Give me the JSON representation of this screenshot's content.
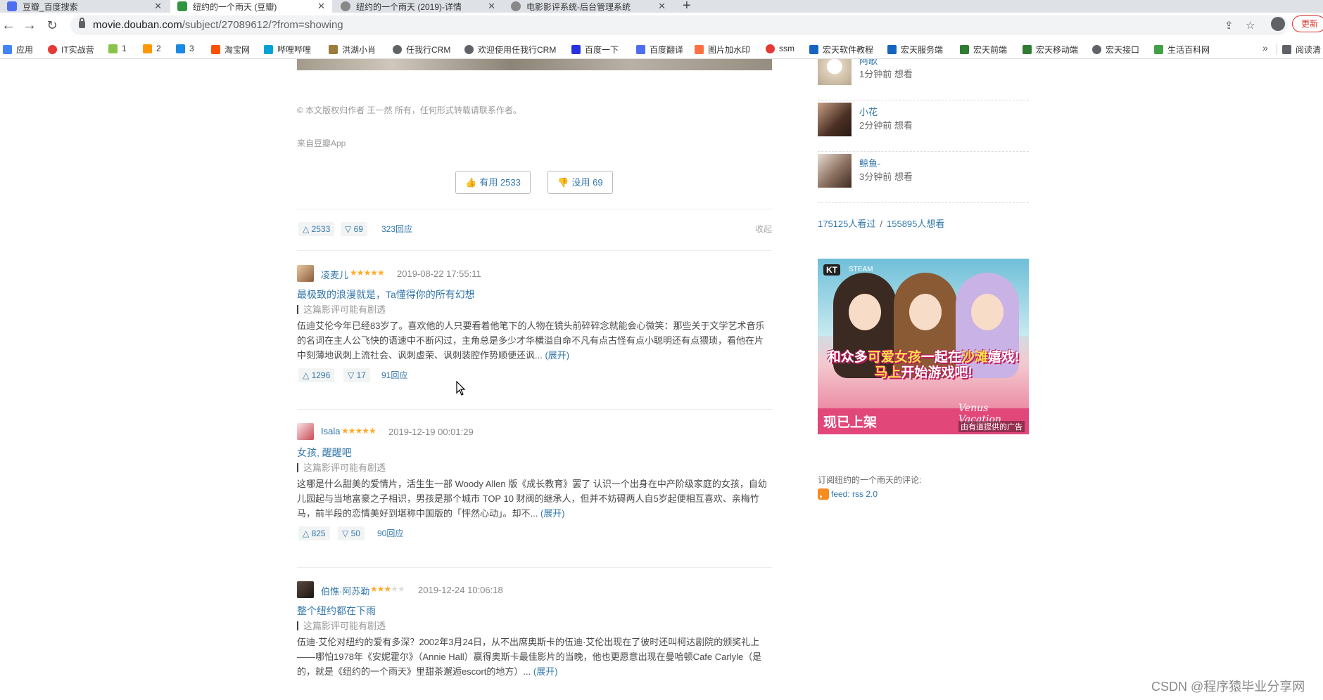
{
  "browser": {
    "tabs": [
      {
        "title": "豆瓣_百度搜索",
        "color": "#4e6ef2"
      },
      {
        "title": "纽约的一个雨天 (豆瓣)",
        "color": "#2e963d"
      },
      {
        "title": "纽约的一个雨天 (2019)-详情",
        "color": "#666666"
      },
      {
        "title": "电影影评系统-后台管理系统",
        "color": "#666666"
      }
    ],
    "new_tab": "+",
    "url_host": "movie.douban.com",
    "url_path": "/subject/27089612/?from=showing",
    "update_label": "更新",
    "bookmarks": [
      {
        "label": "应用",
        "icon": "apps-icon",
        "color": "#4285f4"
      },
      {
        "label": "IT实战营",
        "icon": "itshizhan-icon",
        "color": "#e53935"
      },
      {
        "label": "1",
        "icon": "bookmark-1-icon",
        "color": "#8bc34a"
      },
      {
        "label": "2",
        "icon": "bookmark-2-icon",
        "color": "#ff9800"
      },
      {
        "label": "3",
        "icon": "bookmark-3-icon",
        "color": "#1e88e5"
      },
      {
        "label": "淘宝网",
        "icon": "taobao-icon",
        "color": "#ff5000"
      },
      {
        "label": "哔哩哔哩",
        "icon": "bilibili-icon",
        "color": "#00a1d6"
      },
      {
        "label": "洪湖小肖",
        "icon": "honghu-icon",
        "color": "#9c7b3c"
      },
      {
        "label": "任我行CRM",
        "icon": "globe-icon",
        "color": "#5f6368"
      },
      {
        "label": "欢迎使用任我行CRM",
        "icon": "globe-icon",
        "color": "#5f6368"
      },
      {
        "label": "百度一下",
        "icon": "baidu-icon",
        "color": "#2932e1"
      },
      {
        "label": "百度翻译",
        "icon": "baidu-translate-icon",
        "color": "#4e6ef2"
      },
      {
        "label": "图片加水印",
        "icon": "watermark-tool-icon",
        "color": "#ff7043"
      },
      {
        "label": "ssm",
        "icon": "ssm-icon",
        "color": "#e53935"
      },
      {
        "label": "宏天软件教程",
        "icon": "hongtian-icon",
        "color": "#1565c0"
      },
      {
        "label": "宏天服务端",
        "icon": "hongtian-icon",
        "color": "#1565c0"
      },
      {
        "label": "宏天前端",
        "icon": "vue-icon",
        "color": "#2e7d32"
      },
      {
        "label": "宏天移动端",
        "icon": "vue-icon",
        "color": "#2e7d32"
      },
      {
        "label": "宏天接口",
        "icon": "globe-icon",
        "color": "#5f6368"
      },
      {
        "label": "生活百科网",
        "icon": "book-icon",
        "color": "#43a047"
      }
    ],
    "more_bookmarks": "»",
    "reading_list": "阅读清"
  },
  "main": {
    "copyright": "© 本文版权归作者  王一然  所有，任何形式转载请联系作者。",
    "from_app": "来自豆瓣App",
    "useful_button": "有用 2533",
    "useless_button": "没用 69",
    "main_actions": {
      "up": "2533",
      "down": "69",
      "replies": "323回应",
      "collect": "收起"
    },
    "reviews": [
      {
        "author": "凌麦儿",
        "stars": 5,
        "date": "2019-08-22 17:55:11",
        "title": "最极致的浪漫就是，Ta懂得你的所有幻想",
        "spoiler": "这篇影评可能有剧透",
        "body": "伍迪艾伦今年已经83岁了。喜欢他的人只要看着他笔下的人物在镜头前碎碎念就能会心微笑：那些关于文学艺术音乐的名词在主人公飞快的语速中不断闪过，主角总是多少才华横溢自命不凡有点古怪有点小聪明还有点猥琐，看他在片中刻薄地讽刺上流社会、讽刺虚荣、讽刺装腔作势顺便还讽...",
        "expand": "(展开)",
        "up": "1296",
        "down": "17",
        "replies": "91回应",
        "avatar_color": "#8a5a3c"
      },
      {
        "author": "Isala",
        "stars": 5,
        "date": "2019-12-19 00:01:29",
        "title": "女孩, 醒醒吧",
        "spoiler": "这篇影评可能有剧透",
        "body": "这哪是什么甜美的爱情片，活生生一部 Woody Allen 版《成长教育》罢了 认识一个出身在中产阶级家庭的女孩，自幼儿园起与当地富豪之子相识，男孩是那个城市 TOP 10 财阀的继承人，但并不妨碍两人自5岁起便相互喜欢、亲梅竹马，前半段的恋情美好到堪称中国版的「怦然心动」。却不...",
        "expand": "(展开)",
        "up": "825",
        "down": "50",
        "replies": "90回应",
        "avatar_color": "#d9a0a8"
      },
      {
        "author": "伯憔·阿苏勒",
        "stars": 3,
        "date": "2019-12-24 10:06:18",
        "title": "整个纽约都在下雨",
        "spoiler": "这篇影评可能有剧透",
        "body": "伍迪·艾伦对纽约的爱有多深？2002年3月24日，从不出席奥斯卡的伍迪·艾伦出现在了彼时还叫柯达剧院的颁奖礼上——哪怕1978年《安妮霍尔》（Annie Hall）赢得奥斯卡最佳影片的当晚，他也更愿意出现在曼哈顿Cafe Carlyle（是的，就是《纽约的一个雨天》里甜茶邂逅escort的地方）...",
        "expand": "(展开)",
        "avatar_color": "#3b2f2a"
      }
    ]
  },
  "sidebar": {
    "wishers": [
      {
        "name": "阿歌",
        "time": "1分钟前 想看",
        "avatar_color": "#d8c8b0"
      },
      {
        "name": "小花",
        "time": "2分钟前 想看",
        "avatar_color": "#6b4a3a"
      },
      {
        "name": "鲸鱼-",
        "time": "3分钟前 想看",
        "avatar_color": "#b29a8a"
      }
    ],
    "seen": "175125人看过",
    "slash": "/",
    "want": "155895人想看",
    "ad": {
      "brand_kt": "KT",
      "brand_steam": "STEAM",
      "slogan_line1_a": "和众多",
      "slogan_line1_b": "可爱女孩",
      "slogan_line1_c": "一起在",
      "slogan_line1_d": "沙滩",
      "slogan_line1_e": "嬉戏!",
      "slogan_line2_a": "马上",
      "slogan_line2_b": "开始游戏吧!",
      "now_available": "现已上架",
      "game_name": "Venus Vacation",
      "ad_note": "由有道提供的广告"
    },
    "subscribe": "订阅纽约的一个雨天的评论:",
    "feed": "feed: rss 2.0"
  },
  "watermark": "CSDN @程序猿毕业分享网"
}
